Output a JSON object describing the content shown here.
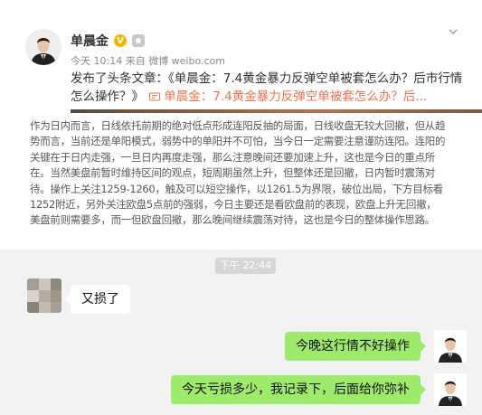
{
  "post": {
    "author": "单晨金",
    "verified_icon": "verified-v-icon",
    "level_icon": "level-badge-icon",
    "meta": "今天 10:14 来自 微博 weibo.com",
    "text_prefix": "发布了头条文章：《单晨金：7.4黄金暴力反弹空单被套怎么办？后市行情怎么操作？》",
    "link_text": "单晨金：7.4黄金暴力反弹空单被套怎么办？后...",
    "article": "作为日内而言，日线依托前期的绝对低点形成连阳反抽的局面，日线收盘无较大回撤，但从趋势而言，当前还是单阳模式，弱势中的单阳并不可怕，当今日一定需要注意谨防连阳。连阳的关键在于日内走强，一旦日内再度走强，那么注意晚间还要加速上升，这也是今日的重点所在。当然美盘前暂时维持区间的观点，短周期虽然上升，但整体还是回撤，日内暂时震荡对待。操作上关注1259-1260，触及可以短空操作，以1261.5为界限，破位出局，下方目标看1252附近，另外关注欧盘5点前的强弱，今日主要还是看欧盘前的表现，欧盘上升无回撤，美盘前则需要多，而一但欧盘回撤，那么晚间继续震荡对待，这也是今日的整体操作思路。"
  },
  "chat": {
    "timestamp": "下午 22:44",
    "messages": [
      {
        "side": "left",
        "text": "又损了"
      },
      {
        "side": "right",
        "text": "今晚这行情不好操作"
      },
      {
        "side": "right",
        "text": "今天亏损多少，我记录下，后面给你弥补"
      }
    ]
  },
  "colors": {
    "link": "#eb7350",
    "outgoing_bubble": "#9eea6a",
    "chat_bg": "#f2f2f2",
    "verified": "#f7b500"
  }
}
